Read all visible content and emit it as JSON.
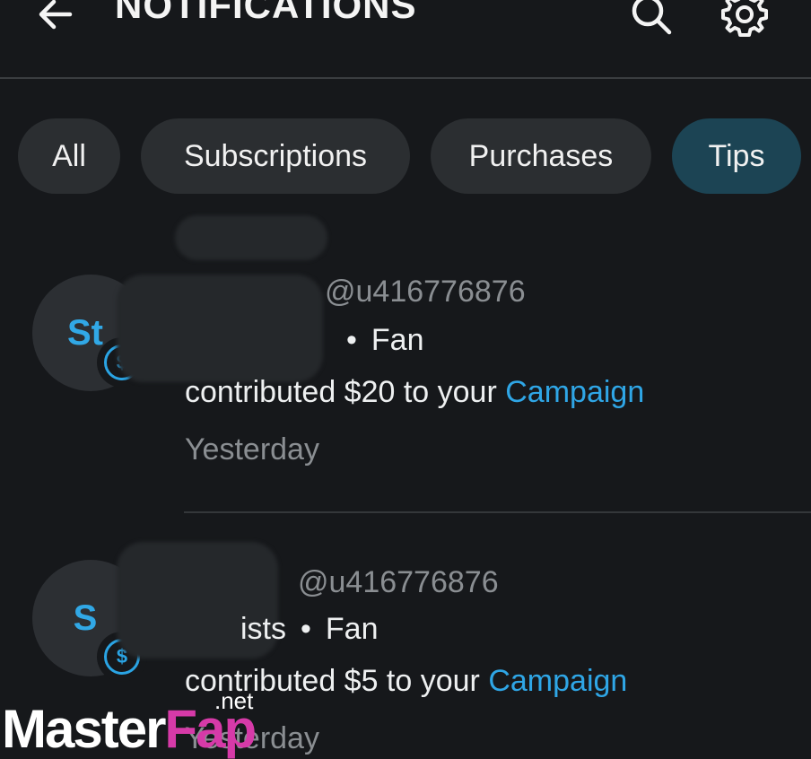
{
  "header": {
    "title": "NOTIFICATIONS"
  },
  "tabs": [
    {
      "label": "All",
      "active": false
    },
    {
      "label": "Subscriptions",
      "active": false
    },
    {
      "label": "Purchases",
      "active": false
    },
    {
      "label": "Tips",
      "active": true
    }
  ],
  "notifications": [
    {
      "avatar_initials": "St",
      "badge_icon": "dollar-coin-icon",
      "handle": "@u416776876",
      "role": "Fan",
      "message_prefix": "contributed $20 to your",
      "message_link": "Campaign",
      "time": "Yesterday"
    },
    {
      "avatar_initials": "S",
      "badge_icon": "dollar-coin-icon",
      "handle": "@u416776876",
      "name_fragment": "ists",
      "role": "Fan",
      "message_prefix": "contributed $5 to your",
      "message_link": "Campaign",
      "time": "Yesterday"
    }
  ],
  "watermark": {
    "brand_a": "Master",
    "brand_b": "Fap",
    "tld": ".net"
  },
  "colors": {
    "background": "#16181b",
    "tab_active": "#1c4454",
    "accent": "#2fa6e6"
  }
}
